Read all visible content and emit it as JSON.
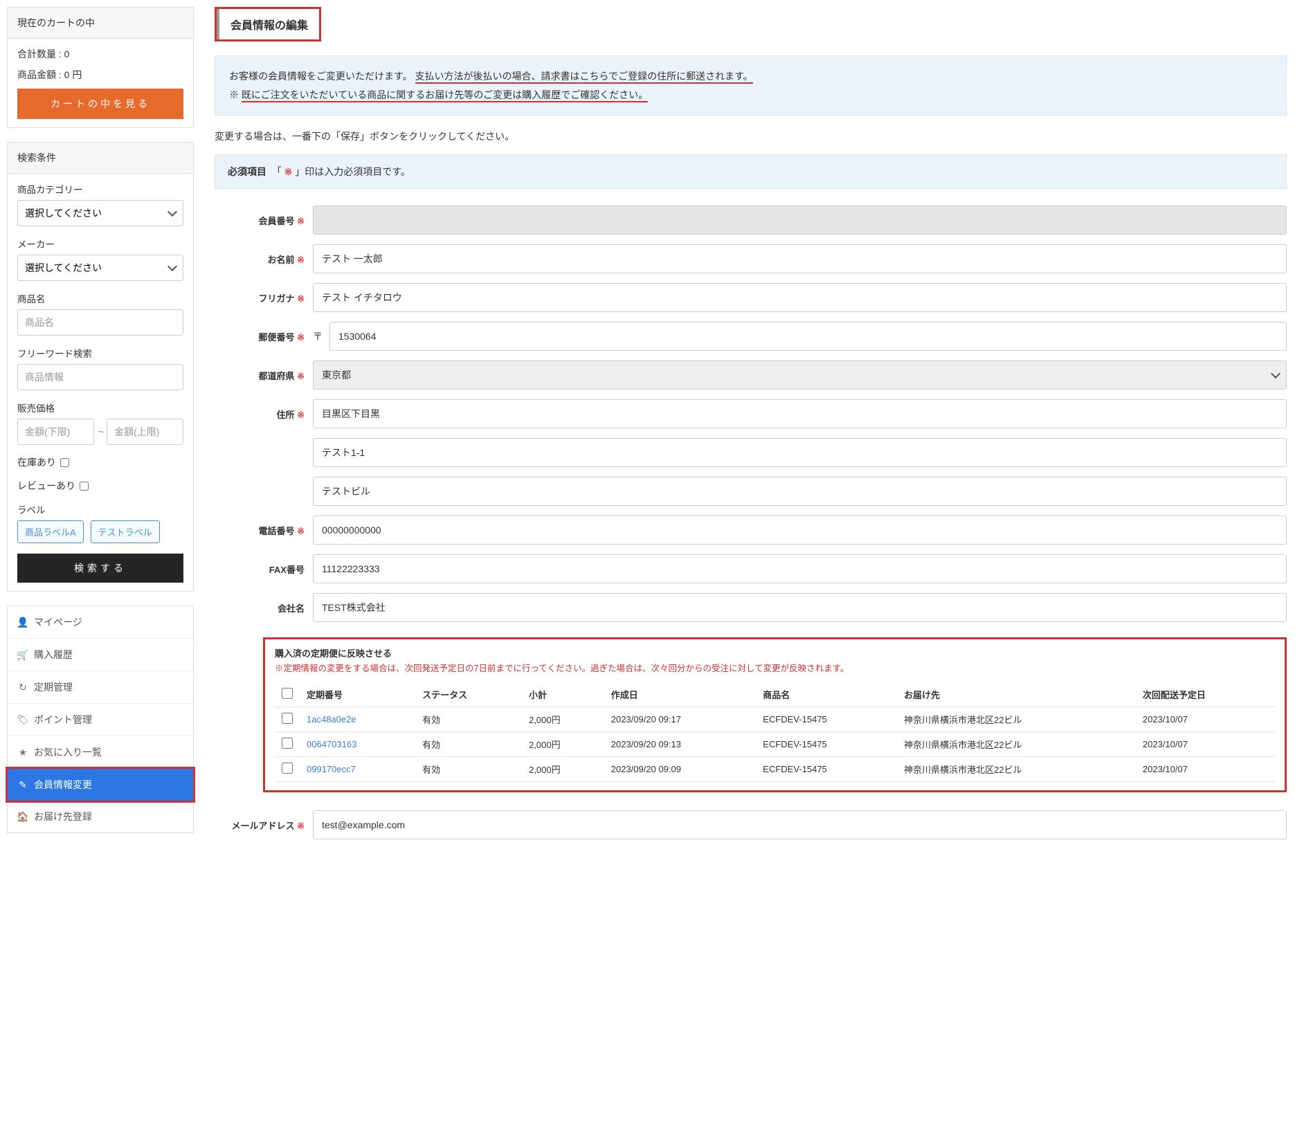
{
  "sidebar": {
    "cart": {
      "header": "現在のカートの中",
      "qty_label": "合計数量 :",
      "qty_value": "0",
      "amount_label": "商品金額 :",
      "amount_value": "0 円",
      "view_cart_btn": "カートの中を見る"
    },
    "search": {
      "header": "検索条件",
      "category_label": "商品カテゴリー",
      "category_placeholder": "選択してください",
      "maker_label": "メーカー",
      "maker_placeholder": "選択してください",
      "name_label": "商品名",
      "name_placeholder": "商品名",
      "freeword_label": "フリーワード検索",
      "freeword_placeholder": "商品情報",
      "price_label": "販売価格",
      "price_min_placeholder": "金額(下限)",
      "price_max_placeholder": "金額(上限)",
      "price_sep": "~",
      "instock_label": "在庫あり",
      "review_label": "レビューあり",
      "labels_label": "ラベル",
      "label_a": "商品ラベルA",
      "label_b": "テストラベル",
      "search_btn": "検索する"
    },
    "nav": {
      "mypage": "マイページ",
      "history": "購入履歴",
      "subscription": "定期管理",
      "points": "ポイント管理",
      "favorites": "お気に入り一覧",
      "member_edit": "会員情報変更",
      "addresses": "お届け先登録"
    }
  },
  "main": {
    "title": "会員情報の編集",
    "info_part1": "お客様の会員情報をご変更いただけます。",
    "info_part2": "支払い方法が後払いの場合、請求書はこちらでご登録の住所に郵送されます。",
    "info_part3_prefix": "※",
    "info_part3": "既にご注文をいただいている商品に関するお届け先等のご変更は購入履歴でご確認ください。",
    "change_note": "変更する場合は、一番下の「保存」ボタンをクリックしてください。",
    "required_label": "必須項目",
    "required_text": "「 ※ 」印は入力必須項目です。",
    "required_mark": "※",
    "labels": {
      "member_no": "会員番号",
      "name": "お名前",
      "kana": "フリガナ",
      "zip": "郵便番号",
      "zip_prefix": "〒",
      "pref": "都道府県",
      "address": "住所",
      "tel": "電話番号",
      "fax": "FAX番号",
      "company": "会社名",
      "email": "メールアドレス"
    },
    "values": {
      "name": "テスト 一太郎",
      "kana": "テスト イチタロウ",
      "zip": "1530064",
      "pref": "東京都",
      "addr1": "目黒区下目黒",
      "addr2": "テスト1-1",
      "addr3": "テストビル",
      "tel": "00000000000",
      "fax": "11122223333",
      "company": "TEST株式会社",
      "email": "test@example.com"
    },
    "reflect": {
      "title": "購入済の定期便に反映させる",
      "note": "※定期情報の変更をする場合は、次回発送予定日の7日前までに行ってください。過ぎた場合は、次々回分からの受注に対して変更が反映されます。",
      "headers": {
        "sub_no": "定期番号",
        "status": "ステータス",
        "subtotal": "小計",
        "created": "作成日",
        "product": "商品名",
        "delivery": "お届け先",
        "next": "次回配送予定日"
      },
      "rows": [
        {
          "sub_no": "1ac48a0e2e",
          "status": "有効",
          "subtotal": "2,000円",
          "created": "2023/09/20 09:17",
          "product": "ECFDEV-15475",
          "delivery": "神奈川県横浜市港北区22ビル",
          "next": "2023/10/07"
        },
        {
          "sub_no": "0064703163",
          "status": "有効",
          "subtotal": "2,000円",
          "created": "2023/09/20 09:13",
          "product": "ECFDEV-15475",
          "delivery": "神奈川県横浜市港北区22ビル",
          "next": "2023/10/07"
        },
        {
          "sub_no": "099170ecc7",
          "status": "有効",
          "subtotal": "2,000円",
          "created": "2023/09/20 09:09",
          "product": "ECFDEV-15475",
          "delivery": "神奈川県横浜市港北区22ビル",
          "next": "2023/10/07"
        }
      ]
    }
  }
}
